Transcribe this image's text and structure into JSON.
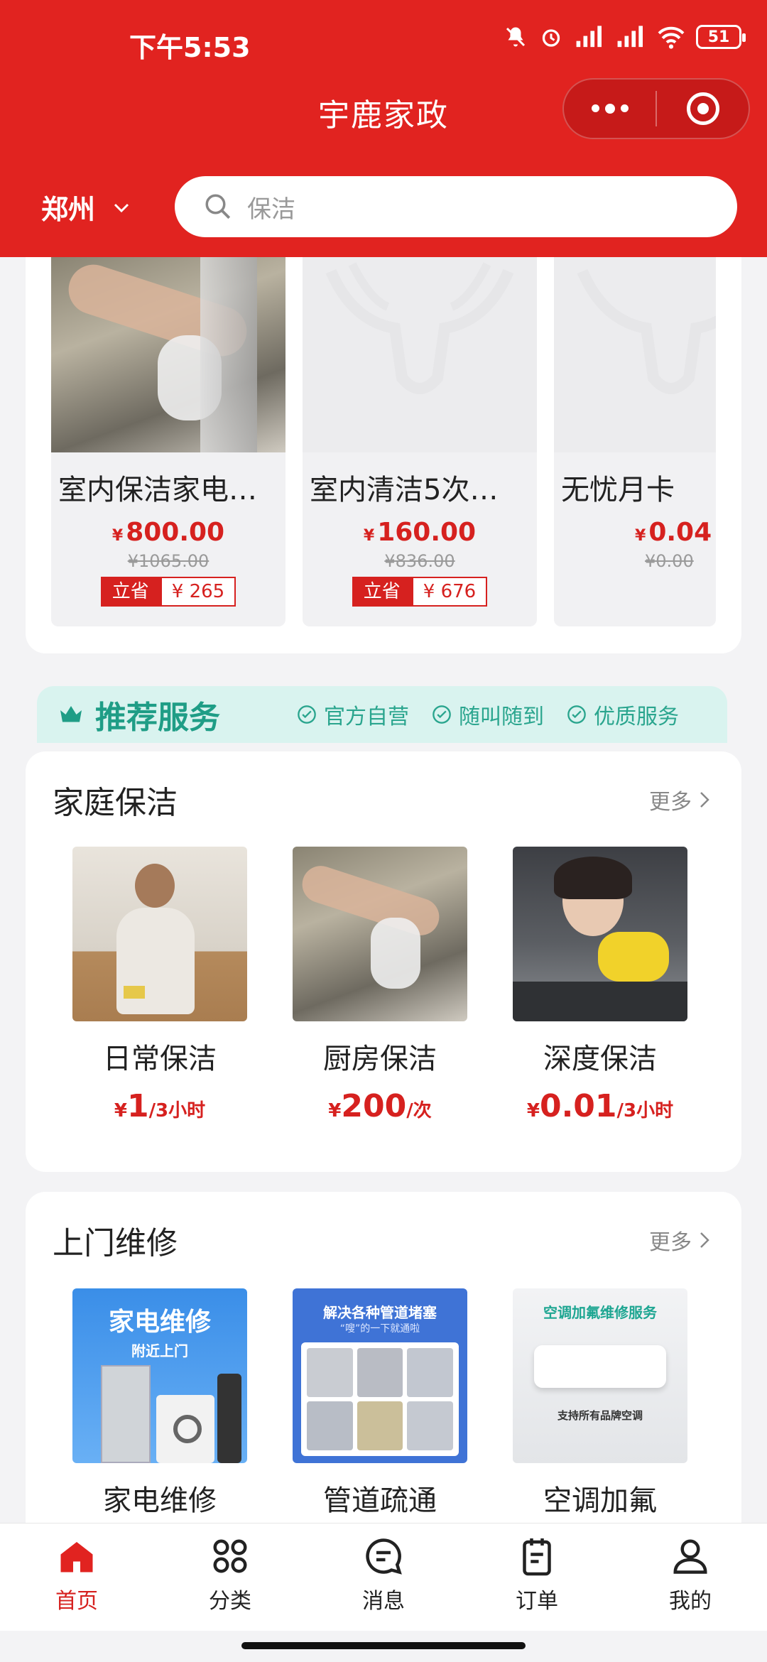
{
  "status_bar": {
    "time": "下午5:53",
    "battery": "51"
  },
  "header": {
    "title": "宇鹿家政",
    "city": "郑州",
    "search_placeholder": "保洁"
  },
  "products": [
    {
      "name": "室内保洁家电…",
      "price": "800.00",
      "orig": "¥1065.00",
      "save_label": "立省",
      "save_amount": "¥ 265"
    },
    {
      "name": "室内清洁5次…",
      "price": "160.00",
      "orig": "¥836.00",
      "save_label": "立省",
      "save_amount": "¥ 676"
    },
    {
      "name": "无忧月卡",
      "price": "0.04",
      "orig": "¥0.00"
    }
  ],
  "currency": "¥",
  "recommend": {
    "title": "推荐服务",
    "features": [
      "官方自营",
      "随叫随到",
      "优质服务"
    ]
  },
  "home_cleaning": {
    "title": "家庭保洁",
    "more": "更多",
    "items": [
      {
        "name": "日常保洁",
        "price": "1",
        "unit": "/3小时"
      },
      {
        "name": "厨房保洁",
        "price": "200",
        "unit": "/次"
      },
      {
        "name": "深度保洁",
        "price": "0.01",
        "unit": "/3小时"
      }
    ]
  },
  "repair": {
    "title": "上门维修",
    "more": "更多",
    "items": [
      {
        "name": "家电维修",
        "img_title": "家电维修",
        "img_sub": "附近上门"
      },
      {
        "name": "管道疏通",
        "img_title": "解决各种管道堵塞",
        "img_sub": "“嗖”的一下就通啦"
      },
      {
        "name": "空调加氟",
        "img_title": "空调加氟维修服务",
        "img_sub": "支持所有品牌空调"
      }
    ]
  },
  "tabbar": [
    "首页",
    "分类",
    "消息",
    "订单",
    "我的"
  ],
  "colors": {
    "brand_red": "#e12320",
    "price_red": "#d6211f",
    "teal": "#1f9d86"
  }
}
